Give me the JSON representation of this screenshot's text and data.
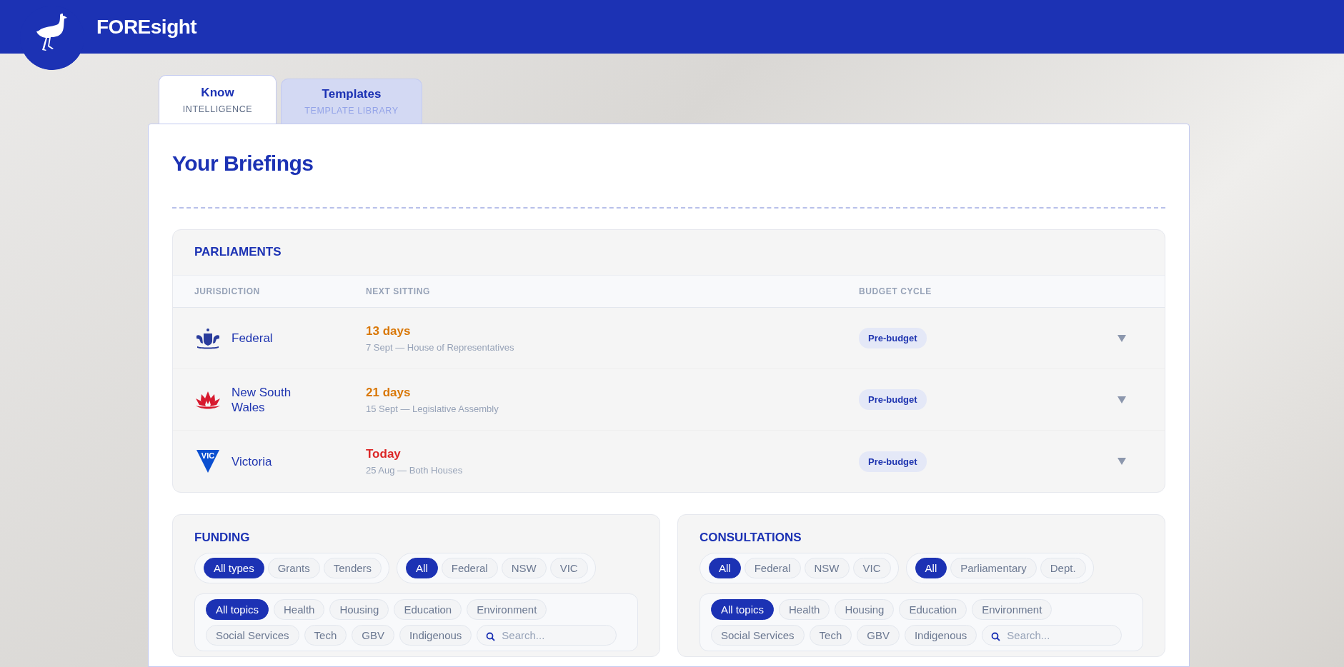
{
  "header": {
    "title": "FOREsight"
  },
  "tabs": [
    {
      "label": "Know",
      "sublabel": "INTELLIGENCE",
      "selected": true
    },
    {
      "label": "Templates",
      "sublabel": "TEMPLATE LIBRARY",
      "selected": false
    }
  ],
  "page_title": "Your Briefings",
  "parliaments": {
    "title": "PARLIAMENTS",
    "columns": [
      "JURISDICTION",
      "NEXT SITTING",
      "BUDGET CYCLE"
    ],
    "rows": [
      {
        "kind": "crest",
        "jurisdiction": "Federal",
        "next_sitting": "13 days",
        "color": "#d97706",
        "detail": "7 Sept — House of Representatives",
        "budget_cycle": "Pre-budget"
      },
      {
        "kind": "waratah",
        "jurisdiction": "New South Wales",
        "next_sitting": "21 days",
        "color": "#d97706",
        "detail": "15 Sept — Legislative Assembly",
        "budget_cycle": "Pre-budget"
      },
      {
        "kind": "triangle",
        "emblem_text": "VIC",
        "jurisdiction": "Victoria",
        "next_sitting": "Today",
        "color": "#dc2626",
        "detail": "25 Aug — Both Houses",
        "budget_cycle": "Pre-budget"
      }
    ]
  },
  "panels": [
    {
      "title": "FUNDING",
      "filter_groups": [
        [
          {
            "label": "All types",
            "selected": true
          },
          {
            "label": "Grants",
            "selected": false
          },
          {
            "label": "Tenders",
            "selected": false
          }
        ],
        [
          {
            "label": "All",
            "selected": true
          },
          {
            "label": "Federal",
            "selected": false
          },
          {
            "label": "NSW",
            "selected": false
          },
          {
            "label": "VIC",
            "selected": false
          }
        ]
      ],
      "topics": [
        {
          "label": "All topics",
          "selected": true
        },
        {
          "label": "Health",
          "selected": false
        },
        {
          "label": "Housing",
          "selected": false
        },
        {
          "label": "Education",
          "selected": false
        },
        {
          "label": "Environment",
          "selected": false
        },
        {
          "label": "Social Services",
          "selected": false
        },
        {
          "label": "Tech",
          "selected": false
        },
        {
          "label": "GBV",
          "selected": false
        },
        {
          "label": "Indigenous",
          "selected": false
        }
      ],
      "search": {
        "placeholder": "Search..."
      }
    },
    {
      "title": "CONSULTATIONS",
      "filter_groups": [
        [
          {
            "label": "All",
            "selected": true
          },
          {
            "label": "Federal",
            "selected": false
          },
          {
            "label": "NSW",
            "selected": false
          },
          {
            "label": "VIC",
            "selected": false
          }
        ],
        [
          {
            "label": "All",
            "selected": true
          },
          {
            "label": "Parliamentary",
            "selected": false
          },
          {
            "label": "Dept.",
            "selected": false
          }
        ]
      ],
      "topics": [
        {
          "label": "All topics",
          "selected": true
        },
        {
          "label": "Health",
          "selected": false
        },
        {
          "label": "Housing",
          "selected": false
        },
        {
          "label": "Education",
          "selected": false
        },
        {
          "label": "Environment",
          "selected": false
        },
        {
          "label": "Social Services",
          "selected": false
        },
        {
          "label": "Tech",
          "selected": false
        },
        {
          "label": "GBV",
          "selected": false
        },
        {
          "label": "Indigenous",
          "selected": false
        }
      ],
      "search": {
        "placeholder": "Search..."
      }
    }
  ]
}
